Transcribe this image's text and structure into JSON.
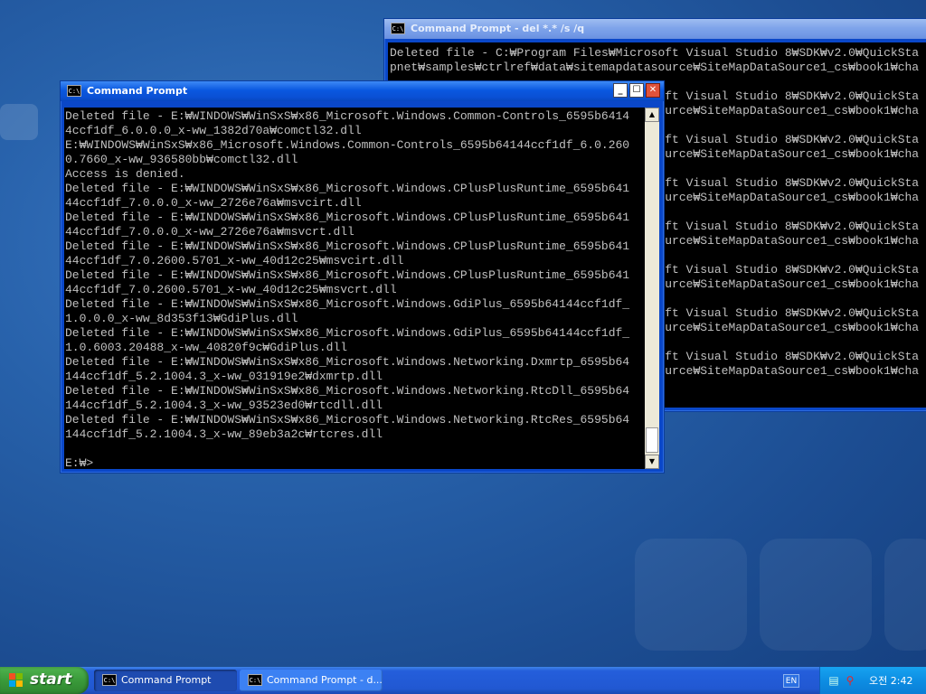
{
  "desktop": {
    "back_window": {
      "icon": "C:\\",
      "title": "Command Prompt - del *.* /s /q",
      "lines": [
        "Deleted file - C:₩Program Files₩Microsoft Visual Studio 8₩SDK₩v2.0₩QuickSta",
        "pnet₩samples₩ctrlref₩data₩sitemapdatasource₩SiteMapDataSource1_cs₩book1₩cha",
        "",
        "Deleted file - C:₩Program Files₩Microsoft Visual Studio 8₩SDK₩v2.0₩QuickSta",
        "pnet₩samples₩ctrlref₩data₩sitemapdatasource₩SiteMapDataSource1_cs₩book1₩cha",
        "",
        "Deleted file - C:₩Program Files₩Microsoft Visual Studio 8₩SDK₩v2.0₩QuickSta",
        "pnet₩samples₩ctrlref₩data₩sitemapdatasource₩SiteMapDataSource1_cs₩book1₩cha",
        "",
        "Deleted file - C:₩Program Files₩Microsoft Visual Studio 8₩SDK₩v2.0₩QuickSta",
        "pnet₩samples₩ctrlref₩data₩sitemapdatasource₩SiteMapDataSource1_cs₩book1₩cha",
        "",
        "Deleted file - C:₩Program Files₩Microsoft Visual Studio 8₩SDK₩v2.0₩QuickSta",
        "pnet₩samples₩ctrlref₩data₩sitemapdatasource₩SiteMapDataSource1_cs₩book1₩cha",
        "",
        "Deleted file - C:₩Program Files₩Microsoft Visual Studio 8₩SDK₩v2.0₩QuickSta",
        "pnet₩samples₩ctrlref₩data₩sitemapdatasource₩SiteMapDataSource1_cs₩book1₩cha",
        "",
        "Deleted file - C:₩Program Files₩Microsoft Visual Studio 8₩SDK₩v2.0₩QuickSta",
        "pnet₩samples₩ctrlref₩data₩sitemapdatasource₩SiteMapDataSource1_cs₩book1₩cha",
        "",
        "Deleted file - C:₩Program Files₩Microsoft Visual Studio 8₩SDK₩v2.0₩QuickSta",
        "pnet₩samples₩ctrlref₩data₩sitemapdatasource₩SiteMapDataSource1_cs₩book1₩cha"
      ]
    },
    "front_window": {
      "icon": "C:\\",
      "title": "Command Prompt",
      "buttons": {
        "minimize": "_",
        "maximize": "☐",
        "close": "✕"
      },
      "lines": [
        "Deleted file - E:₩WINDOWS₩WinSxS₩x86_Microsoft.Windows.Common-Controls_6595b6414",
        "4ccf1df_6.0.0.0_x-ww_1382d70a₩comctl32.dll",
        "E:₩WINDOWS₩WinSxS₩x86_Microsoft.Windows.Common-Controls_6595b64144ccf1df_6.0.260",
        "0.7660_x-ww_936580bb₩comctl32.dll",
        "Access is denied.",
        "Deleted file - E:₩WINDOWS₩WinSxS₩x86_Microsoft.Windows.CPlusPlusRuntime_6595b641",
        "44ccf1df_7.0.0.0_x-ww_2726e76a₩msvcirt.dll",
        "Deleted file - E:₩WINDOWS₩WinSxS₩x86_Microsoft.Windows.CPlusPlusRuntime_6595b641",
        "44ccf1df_7.0.0.0_x-ww_2726e76a₩msvcrt.dll",
        "Deleted file - E:₩WINDOWS₩WinSxS₩x86_Microsoft.Windows.CPlusPlusRuntime_6595b641",
        "44ccf1df_7.0.2600.5701_x-ww_40d12c25₩msvcirt.dll",
        "Deleted file - E:₩WINDOWS₩WinSxS₩x86_Microsoft.Windows.CPlusPlusRuntime_6595b641",
        "44ccf1df_7.0.2600.5701_x-ww_40d12c25₩msvcrt.dll",
        "Deleted file - E:₩WINDOWS₩WinSxS₩x86_Microsoft.Windows.GdiPlus_6595b64144ccf1df_",
        "1.0.0.0_x-ww_8d353f13₩GdiPlus.dll",
        "Deleted file - E:₩WINDOWS₩WinSxS₩x86_Microsoft.Windows.GdiPlus_6595b64144ccf1df_",
        "1.0.6003.20488_x-ww_40820f9c₩GdiPlus.dll",
        "Deleted file - E:₩WINDOWS₩WinSxS₩x86_Microsoft.Windows.Networking.Dxmrtp_6595b64",
        "144ccf1df_5.2.1004.3_x-ww_031919e2₩dxmrtp.dll",
        "Deleted file - E:₩WINDOWS₩WinSxS₩x86_Microsoft.Windows.Networking.RtcDll_6595b64",
        "144ccf1df_5.2.1004.3_x-ww_93523ed0₩rtcdll.dll",
        "Deleted file - E:₩WINDOWS₩WinSxS₩x86_Microsoft.Windows.Networking.RtcRes_6595b64",
        "144ccf1df_5.2.1004.3_x-ww_89eb3a2c₩rtcres.dll",
        "",
        "E:₩>"
      ],
      "scrollbar": {
        "up": "▲",
        "down": "▼"
      }
    }
  },
  "taskbar": {
    "start_label": "start",
    "items": [
      {
        "icon": "C:\\",
        "label": "Command Prompt"
      },
      {
        "icon": "C:\\",
        "label": "Command Prompt - d..."
      }
    ],
    "language": "EN",
    "clock": "오전 2:42"
  }
}
